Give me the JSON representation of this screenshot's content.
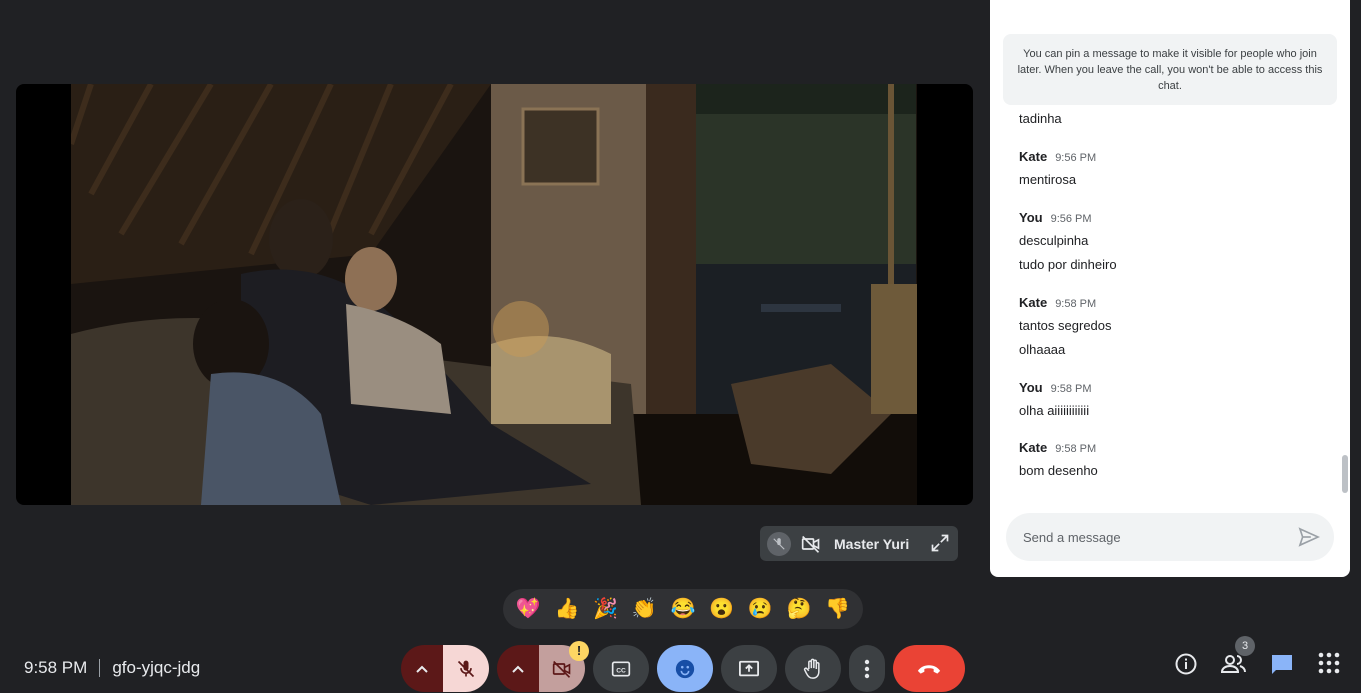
{
  "meeting": {
    "time": "9:58 PM",
    "code": "gfo-yjqc-jdg"
  },
  "self_tile": {
    "name": "Master Yuri"
  },
  "reactions": [
    "💖",
    "👍",
    "🎉",
    "👏",
    "😂",
    "😮",
    "😢",
    "🤔",
    "👎"
  ],
  "toolbar": {
    "camera_warning": "!",
    "people_count": "3",
    "end_call_color": "#ea4335",
    "reaction_active_color": "#8ab4f8"
  },
  "chat": {
    "pin_notice": "You can pin a message to make it visible for people who join later. When you leave the call, you won't be able to access this chat.",
    "cut_message": "tadinha",
    "groups": [
      {
        "sender": "Kate",
        "time": "9:56 PM",
        "messages": [
          "mentirosa"
        ]
      },
      {
        "sender": "You",
        "time": "9:56 PM",
        "messages": [
          "desculpinha",
          "tudo por dinheiro"
        ]
      },
      {
        "sender": "Kate",
        "time": "9:58 PM",
        "messages": [
          "tantos segredos",
          "olhaaaa"
        ]
      },
      {
        "sender": "You",
        "time": "9:58 PM",
        "messages": [
          "olha aiiiiiiiiiiii"
        ]
      },
      {
        "sender": "Kate",
        "time": "9:58 PM",
        "messages": [
          "bom desenho"
        ]
      }
    ],
    "input_placeholder": "Send a message"
  }
}
